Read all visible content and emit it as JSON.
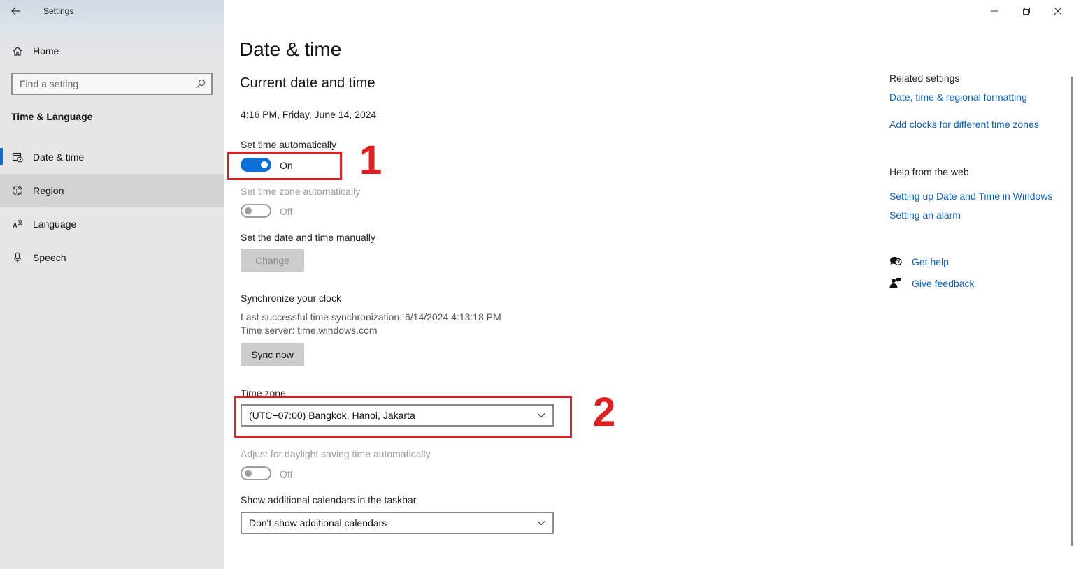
{
  "window": {
    "app_title": "Settings",
    "controls": [
      "minimize",
      "restore",
      "close"
    ]
  },
  "sidebar": {
    "home_label": "Home",
    "search_placeholder": "Find a setting",
    "section_title": "Time & Language",
    "items": [
      {
        "label": "Date & time",
        "icon": "calendar-clock-icon",
        "selected": true
      },
      {
        "label": "Region",
        "icon": "globe-icon",
        "hovered": true
      },
      {
        "label": "Language",
        "icon": "language-icon"
      },
      {
        "label": "Speech",
        "icon": "microphone-icon"
      }
    ]
  },
  "main": {
    "page_title": "Date & time",
    "section_title": "Current date and time",
    "current_datetime": "4:16 PM, Friday, June 14, 2024",
    "set_time_auto": {
      "label": "Set time automatically",
      "state": "On"
    },
    "set_tz_auto": {
      "label": "Set time zone automatically",
      "state": "Off"
    },
    "manual": {
      "label": "Set the date and time manually",
      "button": "Change"
    },
    "sync": {
      "title": "Synchronize your clock",
      "last_sync": "Last successful time synchronization: 6/14/2024 4:13:18 PM",
      "server": "Time server: time.windows.com",
      "button": "Sync now"
    },
    "time_zone": {
      "label": "Time zone",
      "value": "(UTC+07:00) Bangkok, Hanoi, Jakarta"
    },
    "dst": {
      "label": "Adjust for daylight saving time automatically",
      "state": "Off"
    },
    "calendars": {
      "label": "Show additional calendars in the taskbar",
      "value": "Don't show additional calendars"
    }
  },
  "annotations": {
    "first": "1",
    "second": "2",
    "color": "#e02020"
  },
  "related": {
    "title": "Related settings",
    "links": [
      "Date, time & regional formatting",
      "Add clocks for different time zones"
    ],
    "help_title": "Help from the web",
    "help_links": [
      "Setting up Date and Time in Windows",
      "Setting an alarm"
    ],
    "get_help": "Get help",
    "give_feedback": "Give feedback"
  },
  "colors": {
    "accent": "#0a6fd6",
    "link": "#0a62c2",
    "annotation": "#e02020"
  }
}
